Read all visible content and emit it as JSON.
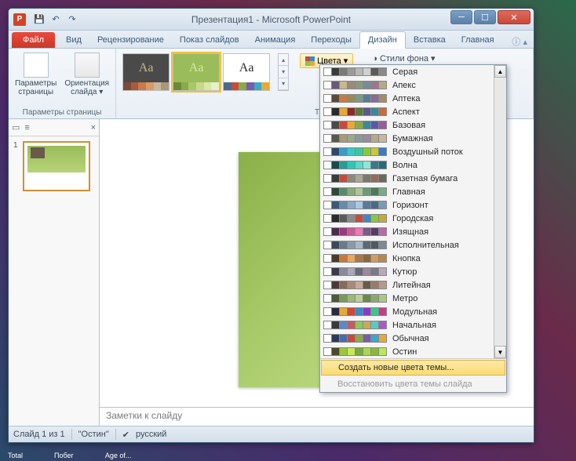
{
  "window": {
    "title": "Презентация1 - Microsoft PowerPoint",
    "app_letter": "P"
  },
  "tabs": {
    "file": "Файл",
    "items": [
      "Главная",
      "Вставка",
      "Дизайн",
      "Переходы",
      "Анимация",
      "Показ слайдов",
      "Рецензирование",
      "Вид"
    ],
    "active_index": 2
  },
  "ribbon": {
    "group1_label": "Параметры страницы",
    "page_setup": "Параметры\nстраницы",
    "orientation": "Ориентация\nслайда",
    "group2_label": "Темы",
    "colors_label": "Цвета",
    "bg_styles": "Стили фона",
    "themes": [
      {
        "bg": "#4a4a4a",
        "fg": "#c8b890",
        "strip": [
          "#7a4a3a",
          "#a85a3a",
          "#c87a4a",
          "#d89a6a",
          "#c8b89a",
          "#a89878"
        ]
      },
      {
        "bg": "#9abc5a",
        "fg": "#d8e8a8",
        "strip": [
          "#6a8a3a",
          "#8aaa4a",
          "#a8c868",
          "#c8d888",
          "#d8e8a8",
          "#e8f0c8"
        ]
      },
      {
        "bg": "#ffffff",
        "fg": "#2a2a2a",
        "strip": [
          "#4a6a8a",
          "#c84a3a",
          "#8aaa4a",
          "#7a5aaa",
          "#3aa8c8",
          "#e8a838"
        ]
      }
    ]
  },
  "thumbnails": {
    "first_num": "1"
  },
  "notes_placeholder": "Заметки к слайду",
  "status": {
    "slide_count": "Слайд 1 из 1",
    "theme": "\"Остин\"",
    "lang": "русский"
  },
  "color_dropdown": {
    "schemes": [
      {
        "label": "Серая",
        "colors": [
          "#fff",
          "#3a3a3a",
          "#7a7a7a",
          "#9a9a9a",
          "#b8b8b8",
          "#d0d0d0",
          "#5a5a5a",
          "#8a8a8a"
        ]
      },
      {
        "label": "Апекс",
        "colors": [
          "#fff",
          "#6a5a7a",
          "#c8b890",
          "#9a8a7a",
          "#8a9a7a",
          "#7a8a9a",
          "#9a7a8a",
          "#b8a888"
        ]
      },
      {
        "label": "Аптека",
        "colors": [
          "#fff",
          "#5a4a3a",
          "#c87a4a",
          "#9a8a5a",
          "#7a9a8a",
          "#5a7a9a",
          "#8a6a9a",
          "#a88a6a"
        ]
      },
      {
        "label": "Аспект",
        "colors": [
          "#fff",
          "#2a2a2a",
          "#e8a838",
          "#8a2a2a",
          "#5a7a3a",
          "#5a5a8a",
          "#3a8a9a",
          "#c86a3a"
        ]
      },
      {
        "label": "Базовая",
        "colors": [
          "#fff",
          "#4a4a4a",
          "#c84a3a",
          "#e8a838",
          "#8aaa4a",
          "#3a8a9a",
          "#5a5aaa",
          "#9a5a9a"
        ]
      },
      {
        "label": "Бумажная",
        "colors": [
          "#fff",
          "#5a5a4a",
          "#a89a7a",
          "#9aaa8a",
          "#8a9a9a",
          "#9a8a9a",
          "#b8a88a",
          "#c8b89a"
        ]
      },
      {
        "label": "Воздушный поток",
        "colors": [
          "#fff",
          "#2a4a6a",
          "#3a9ac8",
          "#3ac8c8",
          "#3ac89a",
          "#8ac83a",
          "#c8c83a",
          "#3a7ac8"
        ]
      },
      {
        "label": "Волна",
        "colors": [
          "#fff",
          "#1a4a4a",
          "#2a9a9a",
          "#2ac8b8",
          "#5ad8c8",
          "#8ae8d8",
          "#3a7a8a",
          "#2a6a7a"
        ]
      },
      {
        "label": "Газетная бумага",
        "colors": [
          "#fff",
          "#3a3a3a",
          "#c84a3a",
          "#8a8a7a",
          "#a8a898",
          "#7a7a6a",
          "#9a6a5a",
          "#6a6a5a"
        ]
      },
      {
        "label": "Главная",
        "colors": [
          "#fff",
          "#2a4a3a",
          "#5a8a6a",
          "#8aaa7a",
          "#a8c898",
          "#6a9a7a",
          "#4a7a5a",
          "#7aaa8a"
        ]
      },
      {
        "label": "Горизонт",
        "colors": [
          "#fff",
          "#3a5a7a",
          "#6a8aaa",
          "#8aaac8",
          "#a8c8e8",
          "#5a7a9a",
          "#4a6a8a",
          "#7a9ab8"
        ]
      },
      {
        "label": "Городская",
        "colors": [
          "#fff",
          "#2a2a2a",
          "#5a5a5a",
          "#8a8a8a",
          "#c84a3a",
          "#3a8ac8",
          "#8ac83a",
          "#c8a83a"
        ]
      },
      {
        "label": "Изящная",
        "colors": [
          "#fff",
          "#4a2a4a",
          "#9a3a7a",
          "#c85a9a",
          "#e87ab8",
          "#7a5a8a",
          "#5a3a6a",
          "#b86aa8"
        ]
      },
      {
        "label": "Исполнительная",
        "colors": [
          "#fff",
          "#3a4a5a",
          "#6a7a8a",
          "#8a9aaa",
          "#a8b8c8",
          "#5a6a7a",
          "#4a5a6a",
          "#7a8a9a"
        ]
      },
      {
        "label": "Кнопка",
        "colors": [
          "#fff",
          "#4a3a2a",
          "#c87a3a",
          "#e8a85a",
          "#a87a4a",
          "#8a6a3a",
          "#d89a5a",
          "#b88a4a"
        ]
      },
      {
        "label": "Кутюр",
        "colors": [
          "#fff",
          "#3a3a4a",
          "#8a8a9a",
          "#a8a8b8",
          "#6a6a7a",
          "#9a8a9a",
          "#7a7a8a",
          "#b8a8b8"
        ]
      },
      {
        "label": "Литейная",
        "colors": [
          "#fff",
          "#4a3a3a",
          "#8a6a5a",
          "#a88a7a",
          "#c8a898",
          "#6a5a4a",
          "#9a7a6a",
          "#b89888"
        ]
      },
      {
        "label": "Метро",
        "colors": [
          "#fff",
          "#4a5a3a",
          "#7a9a5a",
          "#9ab87a",
          "#b8d098",
          "#6a8a4a",
          "#8aaa6a",
          "#a8c888"
        ]
      },
      {
        "label": "Модульная",
        "colors": [
          "#fff",
          "#2a2a3a",
          "#e8a838",
          "#c84a3a",
          "#3a8ac8",
          "#8a3ac8",
          "#3ac88a",
          "#c83a8a"
        ]
      },
      {
        "label": "Начальная",
        "colors": [
          "#fff",
          "#3a3a3a",
          "#5a8ac8",
          "#c85a5a",
          "#8ac85a",
          "#c8a85a",
          "#5ac8c8",
          "#a85ac8"
        ]
      },
      {
        "label": "Обычная",
        "colors": [
          "#fff",
          "#2a3a5a",
          "#4a6aaa",
          "#c84a3a",
          "#8aaa4a",
          "#7a5aaa",
          "#3aa8c8",
          "#e8a838"
        ]
      },
      {
        "label": "Остин",
        "colors": [
          "#fff",
          "#4a4a2a",
          "#9ac83a",
          "#c8e85a",
          "#7aaa3a",
          "#a8d84a",
          "#8ab838",
          "#b8e858"
        ]
      }
    ],
    "create_new": "Создать новые цвета темы...",
    "reset": "Восстановить цвета темы слайда"
  },
  "taskbar": {
    "items": [
      "Total",
      "Побег",
      "Age of..."
    ]
  }
}
